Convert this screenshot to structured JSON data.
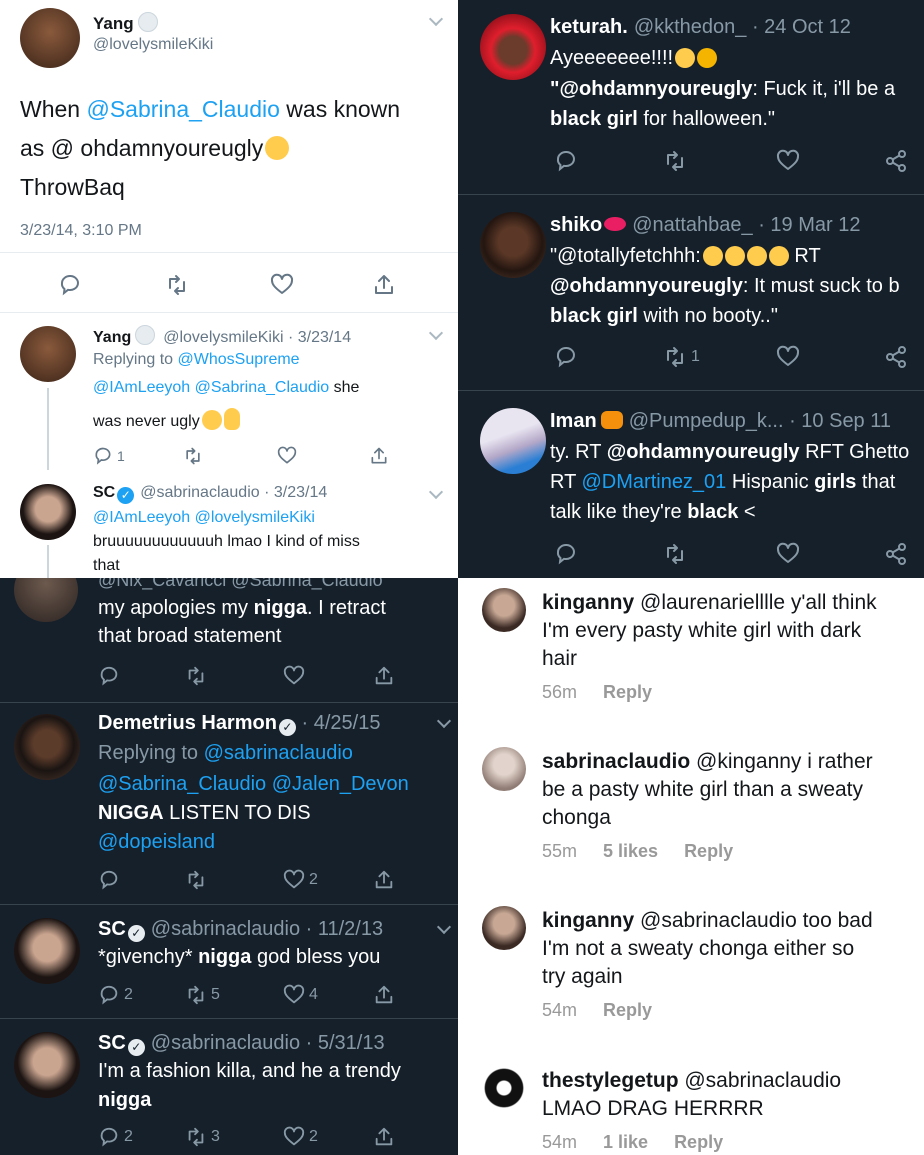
{
  "top_left": {
    "main": {
      "name": "Yang",
      "handle": "@lovelysmileKiki",
      "text_a": "When ",
      "text_mention": "@Sabrina_Claudio",
      "text_b": " was known",
      "text_line2": "as @ ohdamnyoureugly",
      "text_line3": "ThrowBaq",
      "timestamp": "3/23/14, 3:10 PM"
    },
    "reply1": {
      "name": "Yang",
      "handle_date": "@lovelysmileKiki · 3/23/14",
      "replying_prefix": "Replying to ",
      "replying_to": "@WhosSupreme",
      "mention1": "@IAmLeeyoh",
      "mention2": "@Sabrina_Claudio",
      "text_a": " she",
      "text_b": "was never ugly",
      "reply_count": "1"
    },
    "reply2": {
      "name": "SC",
      "handle_date": "@sabrinaclaudio · 3/23/14",
      "mention1": "@IAmLeeyoh",
      "mention2": "@lovelysmileKiki",
      "text_a": "bruuuuuuuuuuuuh lmao I kind of miss",
      "text_b": "that"
    }
  },
  "top_right": {
    "t1": {
      "name": "keturah.",
      "handle_date": "@kkthedon_ · 24 Oct 12",
      "line1": "Ayeeeeeee!!!!",
      "quote_mention": "\"@ohdamnyoureugly",
      "quote_a": ": Fuck it, i'll be a",
      "quote_bold": "black girl",
      "quote_b": " for halloween.\""
    },
    "t2": {
      "name": "shiko",
      "handle_date": "@nattahbae_ · 19 Mar 12",
      "line1_a": "\"@totallyfetchhh:",
      "line1_b": " RT",
      "line2_bold": "@ohdamnyoureugly",
      "line2_b": ": It must suck to b",
      "line3_bold": "black girl",
      "line3_b": " with no booty..\"",
      "retweet_count": "1"
    },
    "t3": {
      "name": "Iman",
      "handle_date": "@Pumpedup_k... · 10 Sep 11",
      "line1_a": "ty. RT ",
      "line1_bold": "@ohdamnyoureugly",
      "line1_b": " RFT Ghetto",
      "line2_a": "RT ",
      "line2_link": "@DMartinez_01",
      "line2_b": " Hispanic ",
      "line2_bold": "girls",
      "line2_c": " that",
      "line3_a": "talk like they're ",
      "line3_bold": "black",
      "line3_b": " <"
    }
  },
  "bottom_left": {
    "t0": {
      "header_cut": "@Nix_Cavaricci  @Sabrina_Claudio",
      "line1_a": "my apologies my ",
      "line1_bold": "nigga",
      "line1_b": ". I retract",
      "line2": "that broad statement"
    },
    "t1": {
      "name": "Demetrius Harmon",
      "date": " · 4/25/15",
      "replying_prefix": "Replying to ",
      "replying_to": "@sabrinaclaudio",
      "mention1": "@Sabrina_Claudio",
      "mention2": "@Jalen_Devon",
      "line_bold": "NIGGA",
      "line_b": " LISTEN TO DIS",
      "mention3": "@dopeisland",
      "like_count": "2"
    },
    "t2": {
      "name": "SC",
      "handle_date": "@sabrinaclaudio · 11/2/13",
      "text_a": "*givenchy* ",
      "text_bold": "nigga",
      "text_b": " god bless you",
      "reply_count": "2",
      "retweet_count": "5",
      "like_count": "4"
    },
    "t3": {
      "name": "SC",
      "handle_date": "@sabrinaclaudio · 5/31/13",
      "line1": "I'm a fashion killa, and he a trendy",
      "line2_bold": "nigga",
      "reply_count": "2",
      "retweet_count": "3",
      "like_count": "2"
    }
  },
  "bottom_right": {
    "c1": {
      "user": "kinganny",
      "text_a": " @laurenarielllle y'all think",
      "line2": "I'm every pasty white girl with dark",
      "line3": "hair",
      "time": "56m",
      "reply": "Reply"
    },
    "c2": {
      "user": "sabrinaclaudio",
      "text_a": " @kinganny i rather",
      "line2": "be a pasty white girl than a sweaty",
      "line3": "chonga",
      "time": "55m",
      "likes": "5 likes",
      "reply": "Reply"
    },
    "c3": {
      "user": "kinganny",
      "text_a": " @sabrinaclaudio too bad",
      "line2": "I'm not a sweaty chonga either so",
      "line3": "try again",
      "time": "54m",
      "reply": "Reply"
    },
    "c4": {
      "user": "thestylegetup",
      "text_a": " @sabrinaclaudio",
      "line2": "LMAO DRAG HERRRR",
      "time": "54m",
      "likes": "1 like",
      "reply": "Reply"
    }
  },
  "colors": {
    "dark_bg": "#15202b",
    "link_blue": "#1da1f2",
    "muted_dark": "#8899a6",
    "muted_light": "#657786"
  }
}
